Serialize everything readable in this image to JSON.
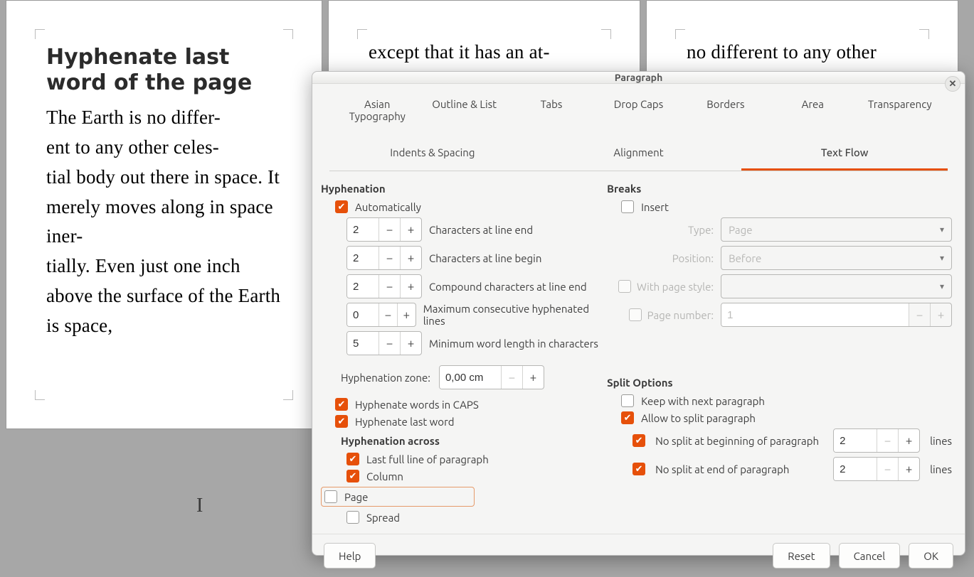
{
  "document": {
    "page1": {
      "heading": "Hyphenate last word of the page",
      "body": "The Earth is no differ-\nent to any other celes-\ntial body out there in space. It merely moves along in space iner-\ntially. Even just one inch above the surface of the Earth is space,"
    },
    "page2": {
      "body": "except that it has an at-"
    },
    "page3": {
      "body": "no different to any other"
    }
  },
  "dialog": {
    "title": "Paragraph",
    "tabs_top": [
      "Asian Typography",
      "Outline & List",
      "Tabs",
      "Drop Caps",
      "Borders",
      "Area",
      "Transparency"
    ],
    "tabs_bottom": [
      "Indents & Spacing",
      "Alignment",
      "Text Flow"
    ],
    "active_tab": "Text Flow",
    "hyphenation": {
      "title": "Hyphenation",
      "automatically": {
        "label": "Automatically",
        "checked": true
      },
      "chars_end": {
        "value": "2",
        "label": "Characters at line end"
      },
      "chars_begin": {
        "value": "2",
        "label": "Characters at line begin"
      },
      "compound": {
        "value": "2",
        "label": "Compound characters at line end"
      },
      "max_consec": {
        "value": "0",
        "label": "Maximum consecutive hyphenated lines"
      },
      "min_word": {
        "value": "5",
        "label": "Minimum word length in characters"
      },
      "zone": {
        "label": "Hyphenation zone:",
        "value": "0,00 cm"
      },
      "caps": {
        "label": "Hyphenate words in CAPS",
        "checked": true
      },
      "last_word": {
        "label": "Hyphenate last word",
        "checked": true
      },
      "across": {
        "title": "Hyphenation across",
        "last_line": {
          "label": "Last full line of paragraph",
          "checked": true
        },
        "column": {
          "label": "Column",
          "checked": true
        },
        "page": {
          "label": "Page",
          "checked": false
        },
        "spread": {
          "label": "Spread",
          "checked": false
        }
      }
    },
    "breaks": {
      "title": "Breaks",
      "insert": {
        "label": "Insert",
        "checked": false
      },
      "type": {
        "label": "Type:",
        "value": "Page"
      },
      "position": {
        "label": "Position:",
        "value": "Before"
      },
      "with_page_style": {
        "label": "With page style:",
        "checked": false,
        "value": ""
      },
      "page_number": {
        "label": "Page number:",
        "checked": false,
        "value": "1"
      }
    },
    "split": {
      "title": "Split Options",
      "keep_next": {
        "label": "Keep with next paragraph",
        "checked": false
      },
      "allow_split": {
        "label": "Allow to split paragraph",
        "checked": true
      },
      "no_split_begin": {
        "label": "No split at beginning of paragraph",
        "checked": true,
        "value": "2",
        "unit": "lines"
      },
      "no_split_end": {
        "label": "No split at end of paragraph",
        "checked": true,
        "value": "2",
        "unit": "lines"
      }
    },
    "footer": {
      "help": "Help",
      "reset": "Reset",
      "cancel": "Cancel",
      "ok": "OK"
    }
  }
}
